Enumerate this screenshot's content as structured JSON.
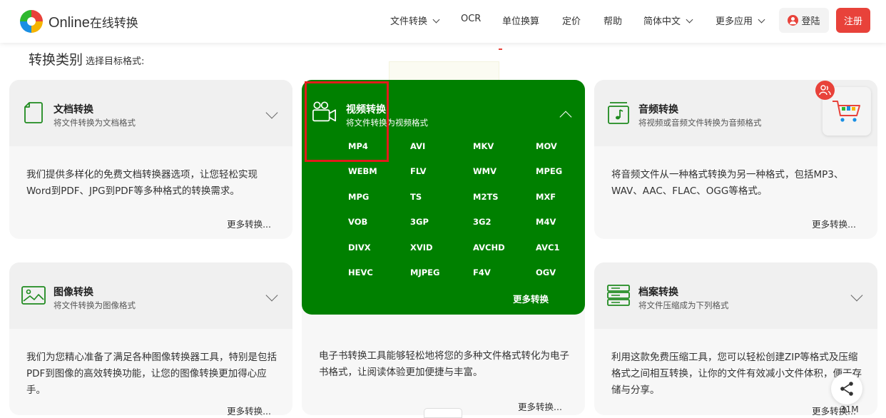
{
  "header": {
    "brand_en": "Online",
    "brand_zh": "在线转换",
    "nav": {
      "file_convert": "文件转换",
      "ocr": "OCR",
      "unit": "单位换算",
      "pricing": "定价",
      "help": "帮助",
      "language": "简体中文",
      "more_apps": "更多应用"
    },
    "login": "登陆",
    "register": "注册"
  },
  "section": {
    "title": "转换类别",
    "subtitle": "选择目标格式:"
  },
  "cards": {
    "document": {
      "title": "文档转换",
      "subtitle": "将文件转换为文档格式",
      "desc": "我们提供多样化的免费文档转换器选项，让您轻松实现Word到PDF、JPG到PDF等多种格式的转换需求。",
      "more": "更多转换..."
    },
    "video": {
      "title": "视频转换",
      "subtitle": "将文件转换为视频格式",
      "formats": [
        "MP4",
        "AVI",
        "MKV",
        "MOV",
        "WEBM",
        "FLV",
        "WMV",
        "MPEG",
        "MPG",
        "TS",
        "M2TS",
        "MXF",
        "VOB",
        "3GP",
        "3G2",
        "M4V",
        "DIVX",
        "XVID",
        "AVCHD",
        "AVC1",
        "HEVC",
        "MJPEG",
        "F4V",
        "OGV"
      ],
      "more": "更多转换"
    },
    "audio": {
      "title": "音频转换",
      "subtitle": "将视频或音频文件转换为音频格式",
      "desc": "将音频文件从一种格式转换为另一种格式，包括MP3、WAV、AAC、FLAC、OGG等格式。",
      "more": "更多转换..."
    },
    "image": {
      "title": "图像转换",
      "subtitle": "将文件转换为图像格式",
      "desc": "我们为您精心准备了满足各种图像转换器工具，特别是包括PDF到图像的高效转换功能，让您的图像转换更加得心应手。",
      "more": "更多转换..."
    },
    "ebook": {
      "desc": "电子书转换工具能够轻松地将您的多种文件格式转化为电子书格式，让阅读体验更加便捷与丰富。",
      "more": "更多转换..."
    },
    "archive": {
      "title": "档案转换",
      "subtitle": "将文件压缩成为下列格式",
      "desc": "利用这款免费压缩工具，您可以轻松创建ZIP等格式及压缩格式之间相互转换，让你的文件有效减小文件体积，便于存储与分享。",
      "more": "更多转换..."
    }
  },
  "floating": {
    "size_text": "31M"
  },
  "colors": {
    "green": "#008000",
    "red": "#e8423a",
    "card_bg": "#f7f7f7"
  }
}
